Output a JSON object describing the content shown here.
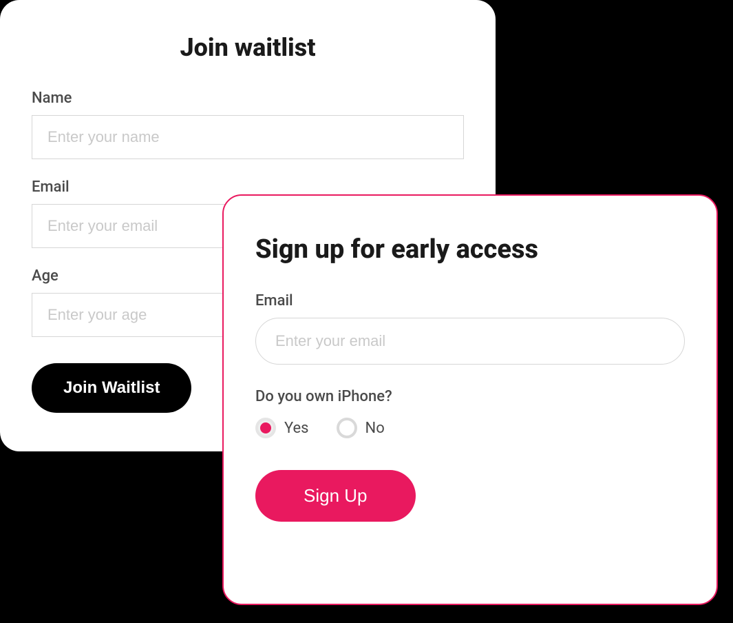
{
  "waitlist": {
    "title": "Join waitlist",
    "name_label": "Name",
    "name_placeholder": "Enter your name",
    "email_label": "Email",
    "email_placeholder": "Enter your email",
    "age_label": "Age",
    "age_placeholder": "Enter your age",
    "button": "Join Waitlist"
  },
  "early": {
    "title": "Sign up for early access",
    "email_label": "Email",
    "email_placeholder": "Enter your email",
    "radio_question": "Do you own iPhone?",
    "radio_yes": "Yes",
    "radio_no": "No",
    "radio_selected": "yes",
    "button": "Sign Up"
  },
  "colors": {
    "accent_pink": "#e9195f",
    "black": "#000000"
  }
}
